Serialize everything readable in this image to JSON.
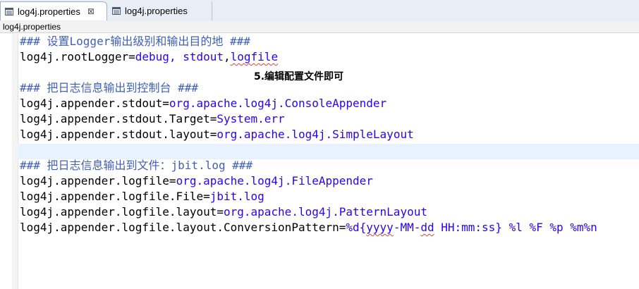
{
  "tabs": [
    {
      "label": "log4j.properties",
      "active": true,
      "close": "⊠"
    },
    {
      "label": "log4j.properties",
      "active": false
    }
  ],
  "breadcrumb": "log4j.properties",
  "annotation": "5.编辑配置文件即可",
  "colors": {
    "comment": "#3f5fbf",
    "value": "#2a00ff",
    "current_line": "#e8f2fe"
  },
  "lines": {
    "l1": {
      "comment": "### 设置Logger输出级别和输出目的地 ###"
    },
    "l2": {
      "key": "log4j.rootLogger=",
      "v1": "debug",
      "v2": ", ",
      "v3": "stdout",
      "v4": ",",
      "v5": "logfile"
    },
    "l3": {},
    "l4": {
      "comment": "### 把日志信息输出到控制台 ###"
    },
    "l5": {
      "key": "log4j.appender.stdout=",
      "value": "org.apache.log4j.ConsoleAppender"
    },
    "l6": {
      "key": "log4j.appender.stdout.Target=",
      "value": "System.err"
    },
    "l7": {
      "key": "log4j.appender.stdout.layout=",
      "value": "org.apache.log4j.SimpleLayout"
    },
    "l8": {},
    "l9": {
      "comment": "### 把日志信息输出到文件：jbit.log ###"
    },
    "l10": {
      "key": "log4j.appender.logfile=",
      "value": "org.apache.log4j.FileAppender"
    },
    "l11": {
      "key": "log4j.appender.logfile.File=",
      "value": "jbit.log"
    },
    "l12": {
      "key": "log4j.appender.logfile.layout=",
      "value": "org.apache.log4j.PatternLayout"
    },
    "l13": {
      "key": "log4j.appender.logfile.layout.ConversionPattern=",
      "v1": "%d{",
      "v2": "yyyy",
      "v3": "-MM-",
      "v4": "dd",
      "v5": " HH:mm:ss} %l %F %p %m%n"
    }
  }
}
